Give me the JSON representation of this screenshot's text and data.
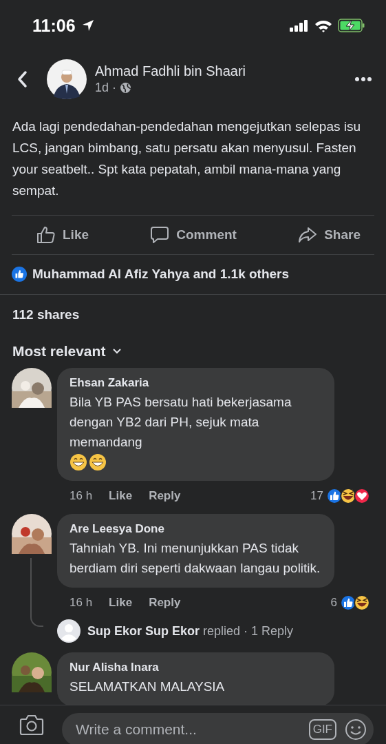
{
  "status_bar": {
    "time": "11:06"
  },
  "post": {
    "author": "Ahmad Fadhli bin Shaari",
    "age": "1d",
    "separator": "·",
    "text": "Ada lagi pendedahan-pendedahan mengejutkan selepas isu LCS, jangan bimbang, satu persatu akan menyusul. Fasten your seatbelt.. Spt kata pepatah, ambil mana-mana yang sempat."
  },
  "actions": [
    {
      "kind": "like",
      "label": "Like"
    },
    {
      "kind": "comment",
      "label": "Comment"
    },
    {
      "kind": "share",
      "label": "Share"
    }
  ],
  "reactions_summary": "Muhammad Al Afiz Yahya and 1.1k others",
  "shares": "112 shares",
  "sort": "Most relevant",
  "comments": [
    {
      "author": "Ehsan Zakaria",
      "text": "Bila YB PAS bersatu hati bekerjasama dengan YB2 dari PH, sejuk mata memandang",
      "emojis": [
        {
          "kind": "grin"
        },
        {
          "kind": "grin"
        }
      ],
      "time": "16 h",
      "like": "Like",
      "reply": "Reply",
      "reaction_count": "17",
      "reactions": [
        {
          "kind": "like"
        },
        {
          "kind": "haha"
        },
        {
          "kind": "love"
        }
      ]
    },
    {
      "author": "Are Leesya Done",
      "text": "Tahniah YB. Ini menunjukkan PAS tidak berdiam diri seperti dakwaan langau politik.",
      "time": "16 h",
      "like": "Like",
      "reply": "Reply",
      "reaction_count": "6",
      "reactions": [
        {
          "kind": "like"
        },
        {
          "kind": "haha"
        }
      ],
      "replies": {
        "author": "Sup Ekor Sup Ekor",
        "verb": "replied",
        "separator": "·",
        "count": "1 Reply"
      }
    },
    {
      "author": "Nur Alisha Inara",
      "text": "SELAMATKAN MALAYSIA"
    }
  ],
  "composer": {
    "placeholder": "Write a comment...",
    "gif": "GIF"
  }
}
